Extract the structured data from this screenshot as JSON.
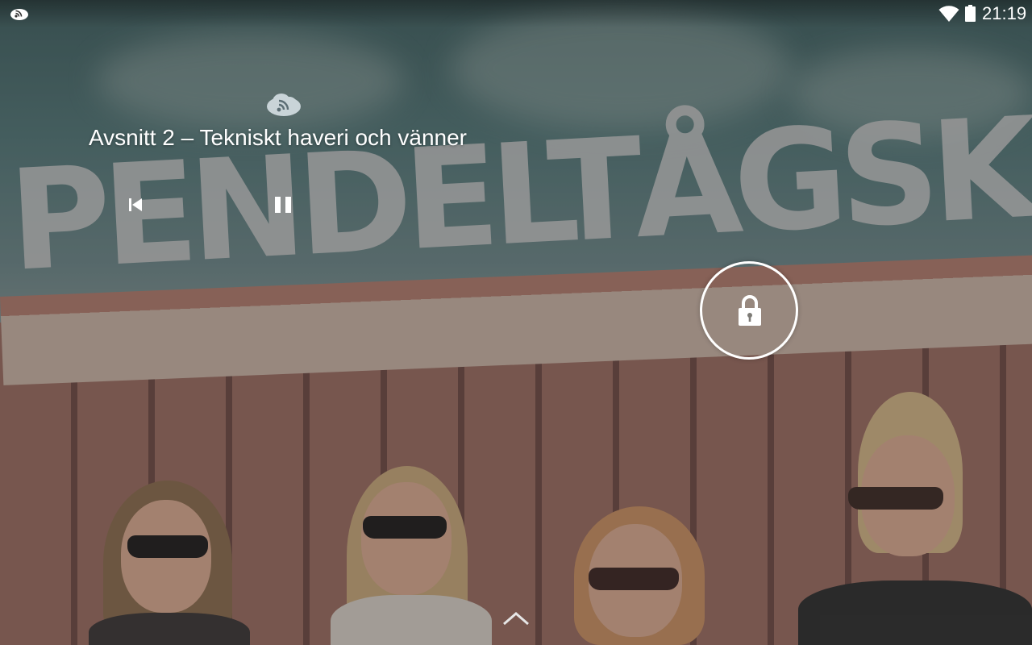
{
  "status_bar": {
    "time": "21:19",
    "icons": [
      "podcast-app-notification-icon",
      "wifi-icon",
      "battery-icon"
    ]
  },
  "background": {
    "sign_text": "PENDELTÅGSKLUBBEN"
  },
  "media_widget": {
    "app_icon": "podcast-cloud-icon",
    "track_title": "Avsnitt 2 – Tekniskt haveri och vänner",
    "controls": [
      "previous-icon",
      "pause-icon"
    ]
  },
  "lock": {
    "icon": "lock-icon"
  },
  "unlock_hint": {
    "icon": "chevron-up-icon"
  },
  "colors": {
    "foreground": "#ffffff",
    "scrim": "rgba(40,40,40,0.30)"
  }
}
